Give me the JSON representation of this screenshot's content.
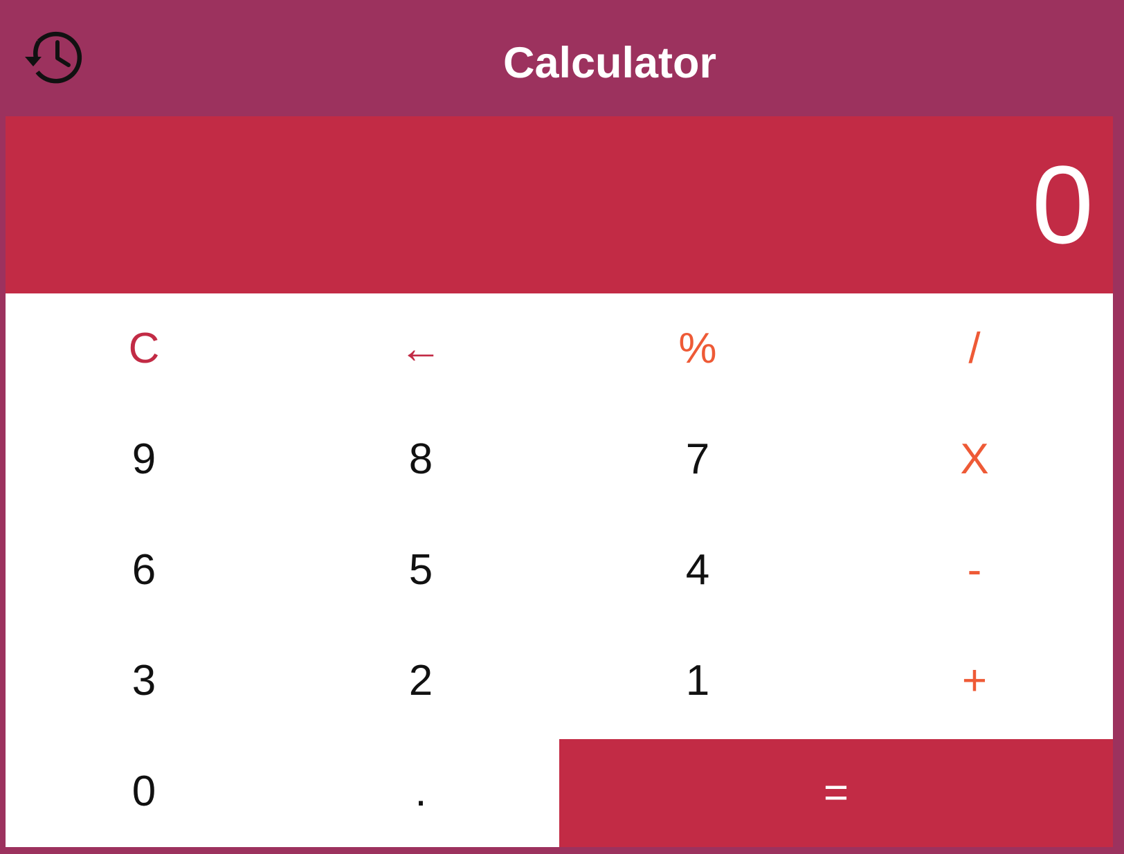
{
  "header": {
    "title": "Calculator",
    "history_icon": "history-icon"
  },
  "display": {
    "value": "0"
  },
  "keypad": {
    "rows": [
      [
        {
          "label": "C",
          "kind": "fn",
          "name": "clear-button"
        },
        {
          "label": "←",
          "kind": "fn",
          "name": "backspace-button"
        },
        {
          "label": "%",
          "kind": "op",
          "name": "percent-button"
        },
        {
          "label": "/",
          "kind": "op",
          "name": "divide-button"
        }
      ],
      [
        {
          "label": "9",
          "kind": "num",
          "name": "digit-9-button"
        },
        {
          "label": "8",
          "kind": "num",
          "name": "digit-8-button"
        },
        {
          "label": "7",
          "kind": "num",
          "name": "digit-7-button"
        },
        {
          "label": "X",
          "kind": "op",
          "name": "multiply-button"
        }
      ],
      [
        {
          "label": "6",
          "kind": "num",
          "name": "digit-6-button"
        },
        {
          "label": "5",
          "kind": "num",
          "name": "digit-5-button"
        },
        {
          "label": "4",
          "kind": "num",
          "name": "digit-4-button"
        },
        {
          "label": "-",
          "kind": "op",
          "name": "subtract-button"
        }
      ],
      [
        {
          "label": "3",
          "kind": "num",
          "name": "digit-3-button"
        },
        {
          "label": "2",
          "kind": "num",
          "name": "digit-2-button"
        },
        {
          "label": "1",
          "kind": "num",
          "name": "digit-1-button"
        },
        {
          "label": "+",
          "kind": "op",
          "name": "add-button"
        }
      ],
      [
        {
          "label": "0",
          "kind": "num",
          "name": "digit-0-button"
        },
        {
          "label": ".",
          "kind": "num",
          "name": "decimal-button"
        },
        {
          "label": "=",
          "kind": "equals",
          "name": "equals-button"
        }
      ]
    ]
  },
  "colors": {
    "frame": "#9c325e",
    "accent": "#c22b45",
    "operator": "#ee5a36",
    "digit": "#111111",
    "keypad_bg": "#ffffff"
  }
}
